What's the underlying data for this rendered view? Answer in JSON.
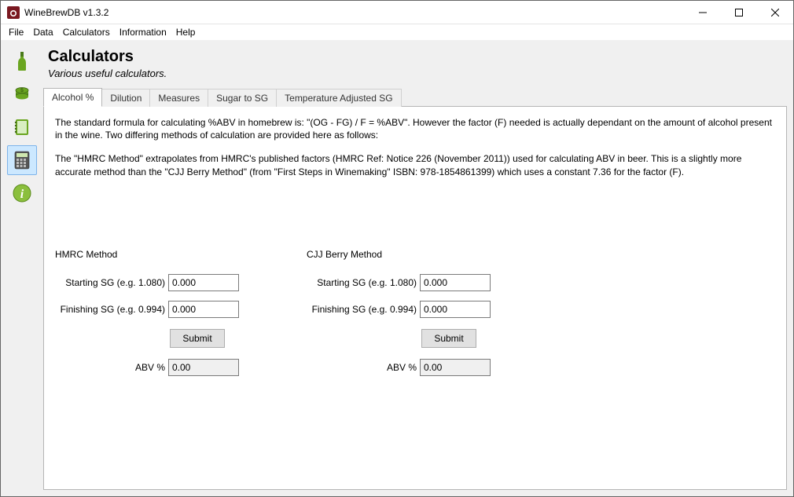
{
  "window": {
    "title": "WineBrewDB v1.3.2"
  },
  "menus": [
    "File",
    "Data",
    "Calculators",
    "Information",
    "Help"
  ],
  "sidebar": {
    "items": [
      {
        "name": "bottle-icon"
      },
      {
        "name": "money-icon"
      },
      {
        "name": "notebook-icon"
      },
      {
        "name": "calculator-icon"
      },
      {
        "name": "info-icon"
      }
    ],
    "selected_index": 3
  },
  "page": {
    "title": "Calculators",
    "subtitle": "Various useful calculators."
  },
  "tabs": {
    "items": [
      "Alcohol %",
      "Dilution",
      "Measures",
      "Sugar to SG",
      "Temperature Adjusted SG"
    ],
    "active_index": 0
  },
  "panel": {
    "para1": "The standard formula for calculating %ABV in homebrew is: \"(OG - FG) / F = %ABV\". However the factor (F) needed is actually dependant on the amount of alcohol present in the wine. Two differing methods of calculation are provided here as follows:",
    "para2": "The \"HMRC Method\" extrapolates from HMRC's published factors (HMRC Ref: Notice 226 (November 2011)) used for calculating ABV in beer. This is a slightly more accurate method than the \"CJJ Berry Method\" (from \"First Steps in Winemaking\" ISBN: 978-1854861399) which uses a constant 7.36 for the factor (F)."
  },
  "methods": {
    "hmrc": {
      "title": "HMRC Method",
      "start_label": "Starting SG (e.g. 1.080)",
      "start_value": "0.000",
      "finish_label": "Finishing SG (e.g. 0.994)",
      "finish_value": "0.000",
      "submit_label": "Submit",
      "result_label": "ABV %",
      "result_value": "0.00"
    },
    "cjj": {
      "title": "CJJ Berry Method",
      "start_label": "Starting SG (e.g. 1.080)",
      "start_value": "0.000",
      "finish_label": "Finishing SG (e.g. 0.994)",
      "finish_value": "0.000",
      "submit_label": "Submit",
      "result_label": "ABV %",
      "result_value": "0.00"
    }
  }
}
